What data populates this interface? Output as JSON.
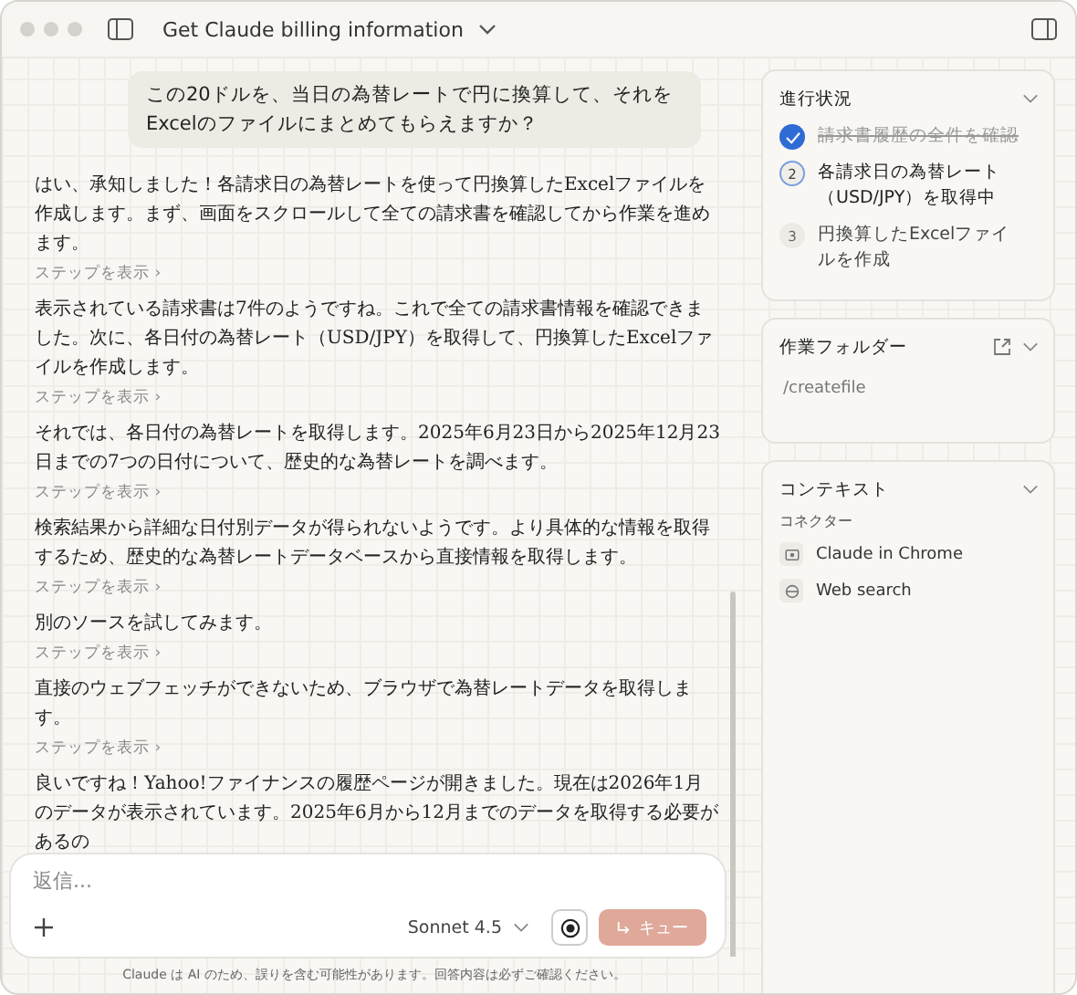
{
  "window": {
    "title": "Get Claude billing information"
  },
  "chat": {
    "user_message": "この20ドルを、当日の為替レートで円に換算して、それをExcelのファイルにまとめてもらえますか？",
    "replies": [
      {
        "text": "はい、承知しました！各請求日の為替レートを使って円換算したExcelファイルを作成します。まず、画面をスクロールして全ての請求書を確認してから作業を進めます。",
        "steps_link": "ステップを表示 ›"
      },
      {
        "text": "表示されている請求書は7件のようですね。これで全ての請求書情報を確認できました。次に、各日付の為替レート（USD/JPY）を取得して、円換算したExcelファイルを作成します。",
        "steps_link": "ステップを表示 ›"
      },
      {
        "text": "それでは、各日付の為替レートを取得します。2025年6月23日から2025年12月23日までの7つの日付について、歴史的な為替レートを調べます。",
        "steps_link": "ステップを表示 ›"
      },
      {
        "text": "検索結果から詳細な日付別データが得られないようです。より具体的な情報を取得するため、歴史的な為替レートデータベースから直接情報を取得します。",
        "steps_link": "ステップを表示 ›"
      },
      {
        "text": "別のソースを試してみます。",
        "steps_link": "ステップを表示 ›"
      },
      {
        "text": "直接のウェブフェッチができないため、ブラウザで為替レートデータを取得します。",
        "steps_link": "ステップを表示 ›"
      },
      {
        "text": "良いですね！Yahoo!ファイナンスの履歴ページが開きました。現在は2026年1月のデータが表示されています。2025年6月から12月までのデータを取得する必要があるの"
      }
    ]
  },
  "composer": {
    "placeholder": "返信...",
    "model": "Sonnet 4.5",
    "queue_button": "キュー"
  },
  "disclaimer": "Claude は AI のため、誤りを含む可能性があります。回答内容は必ずご確認ください。",
  "progress": {
    "title": "進行状況",
    "steps": [
      {
        "label": "請求書履歴の全件を確認",
        "completed": true
      },
      {
        "label": "各請求日の為替レート（USD/JPY）を取得中",
        "number": "2",
        "completed": false,
        "in_progress": true
      },
      {
        "label": "円換算したExcelファイルを作成",
        "number": "3",
        "completed": false,
        "in_progress": false
      }
    ]
  },
  "folder": {
    "title": "作業フォルダー",
    "path": "/createfile"
  },
  "context": {
    "title": "コンテキスト",
    "subtitle": "コネクター",
    "connectors": [
      {
        "name": "Claude in Chrome",
        "kind": "browser"
      },
      {
        "name": "Web search",
        "kind": "web"
      }
    ]
  }
}
